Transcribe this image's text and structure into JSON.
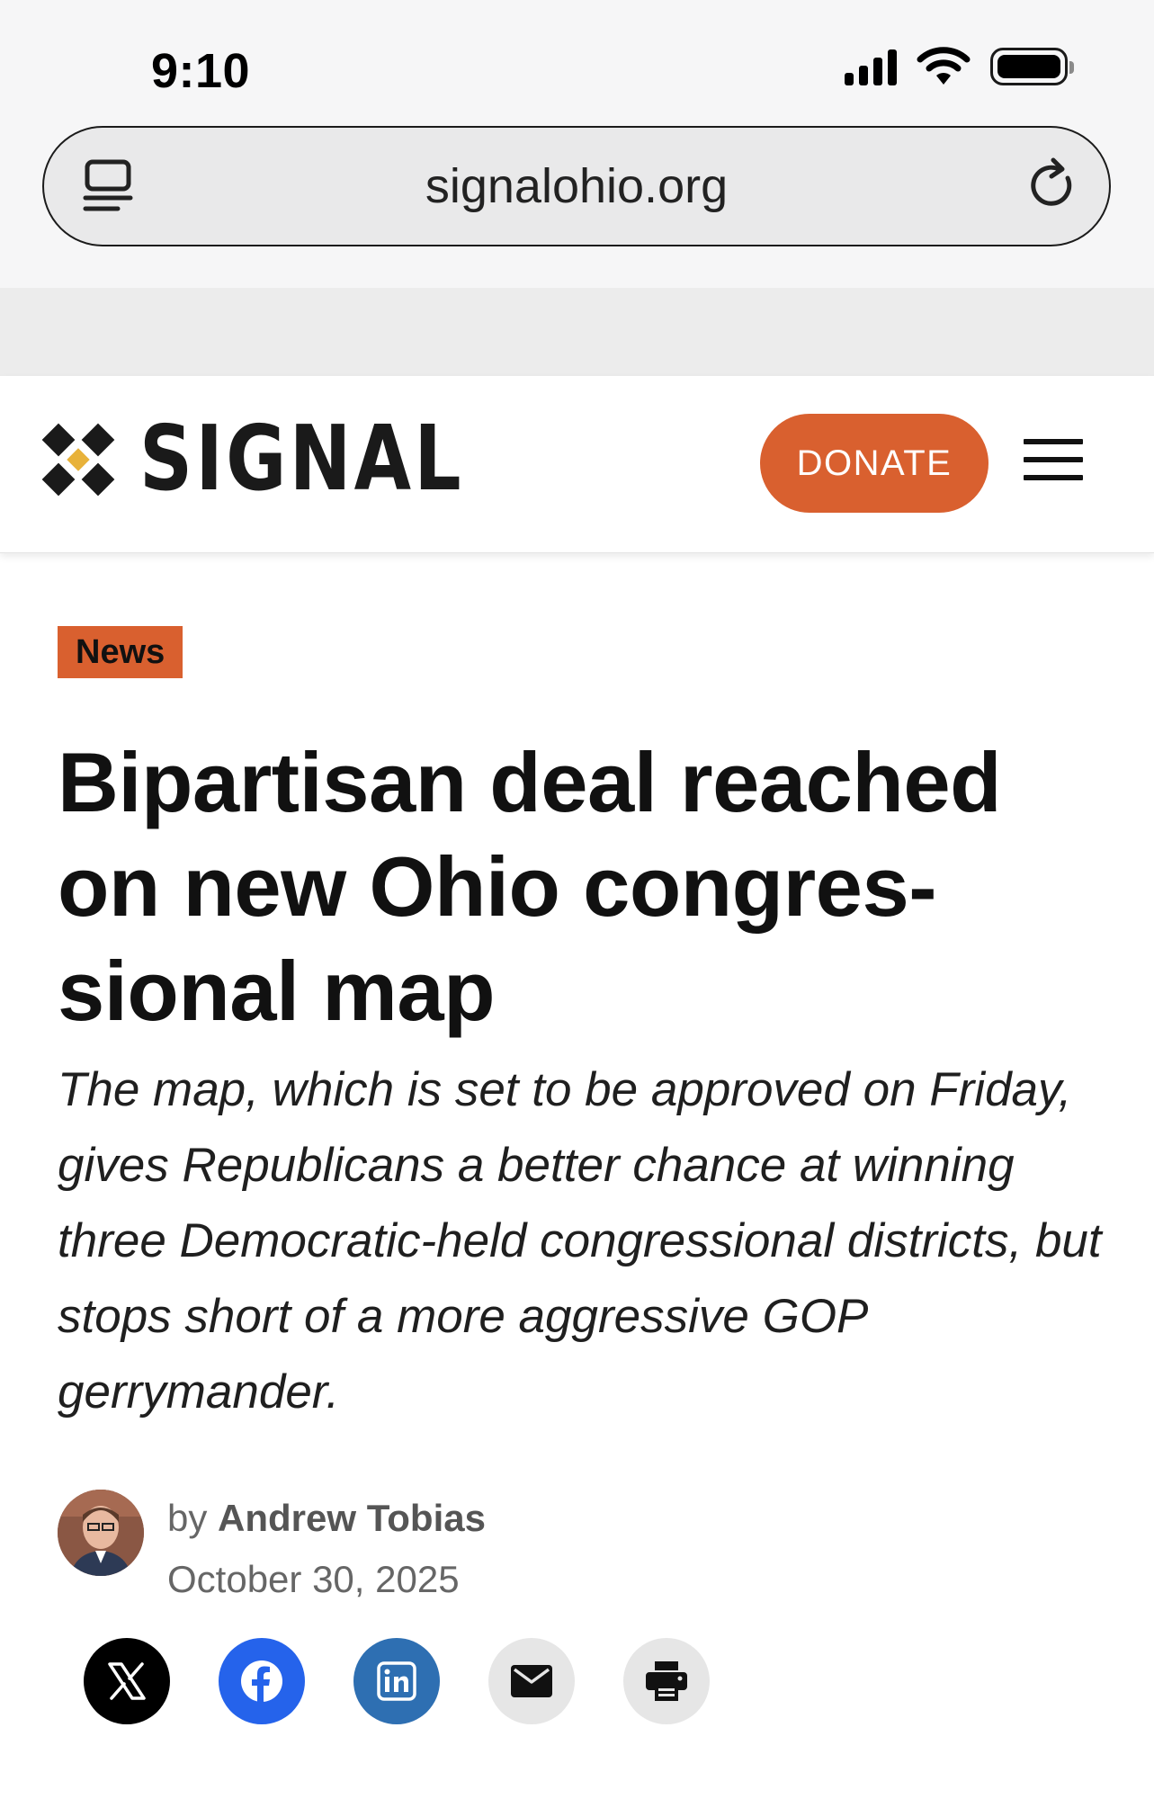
{
  "status_bar": {
    "time": "9:10",
    "icons": [
      "cellular-signal-icon",
      "wifi-icon",
      "battery-icon"
    ]
  },
  "browser": {
    "url": "signalohio.org",
    "left_icon": "reader-icon",
    "right_icon": "reload-icon"
  },
  "site": {
    "logo_text": "SIGNAL",
    "donate_label": "DONATE",
    "menu_icon": "hamburger-menu-icon",
    "accent_color": "#d9602f"
  },
  "article": {
    "category": "News",
    "headline": "Bipartisan deal reached on new Ohio congres-sional map",
    "dek": "The map, which is set to be approved on Friday, gives Republicans a better chance at winning three Democratic-held congressional districts, but stops short of a more aggressive GOP gerrymander.",
    "byline_prefix": "by",
    "author": "Andrew Tobias",
    "date": "October 30, 2025"
  },
  "share": [
    {
      "icon": "x-icon",
      "color": "#000000"
    },
    {
      "icon": "facebook-icon",
      "color": "#2563eb"
    },
    {
      "icon": "linkedin-icon",
      "color": "#2e6fb2"
    },
    {
      "icon": "email-icon",
      "color": "#e6e6e6"
    },
    {
      "icon": "print-icon",
      "color": "#e6e6e6"
    }
  ]
}
